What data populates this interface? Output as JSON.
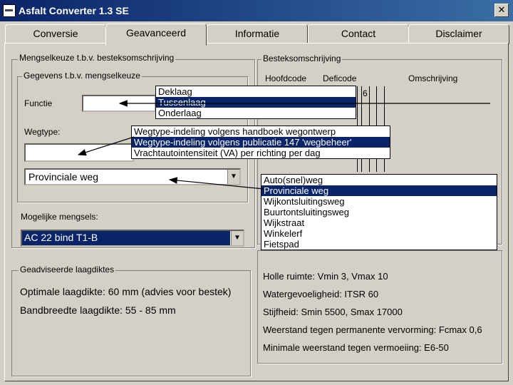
{
  "window": {
    "title": "Asfalt Converter 1.3 SE",
    "close": "✕"
  },
  "tabs": [
    "Conversie",
    "Geavanceerd",
    "Informatie",
    "Contact",
    "Disclaimer"
  ],
  "left": {
    "group_title": "Mengselkeuze t.b.v. besteksomschrijving",
    "sub_group_title": "Gegevens t.b.v. mengselkeuze",
    "functie_label": "Functie",
    "wegtype_label": "Wegtype:",
    "road_select": "Provinciale weg",
    "mix_label": "Mogelijke mengsels:",
    "mix_select": "AC 22 bind T1-B"
  },
  "advice": {
    "title": "Geadviseerde laagdiktes",
    "optimal": "Optimale laagdikte: 60 mm (advies voor bestek)",
    "range": "Bandbreedte laagdikte: 55 - 85 mm"
  },
  "spec": {
    "title": "Besteksomschrijving",
    "columns": [
      "Hoofdcode",
      "Deficode",
      "Omschrijving"
    ],
    "fragment": "6"
  },
  "properties": [
    "Holle ruimte: Vmin 3, Vmax 10",
    "Watergevoeligheid: ITSR 60",
    "Stijfheid: Smin 5500, Smax 17000",
    "Weerstand tegen permanente vervorming: Fcmax 0,6",
    "Minimale weerstand tegen vermoeiing: E6-50"
  ],
  "functie_options": [
    "Deklaag",
    "Tussenlaag",
    "Onderlaag"
  ],
  "functie_selected": 1,
  "wegtype_options": [
    "Wegtype-indeling volgens handboek wegontwerp",
    "Wegtype-indeling volgens publicatie 147 'wegbeheer'",
    "Vrachtautointensiteit (VA) per richting per dag"
  ],
  "wegtype_selected": 1,
  "road_options": [
    "Auto(snel)weg",
    "Provinciale weg",
    "Wijkontsluitingsweg",
    "Buurtontsluitingsweg",
    "Wijkstraat",
    "Winkelerf",
    "Fietspad"
  ],
  "road_selected": 1,
  "combo_arrow": "▼"
}
